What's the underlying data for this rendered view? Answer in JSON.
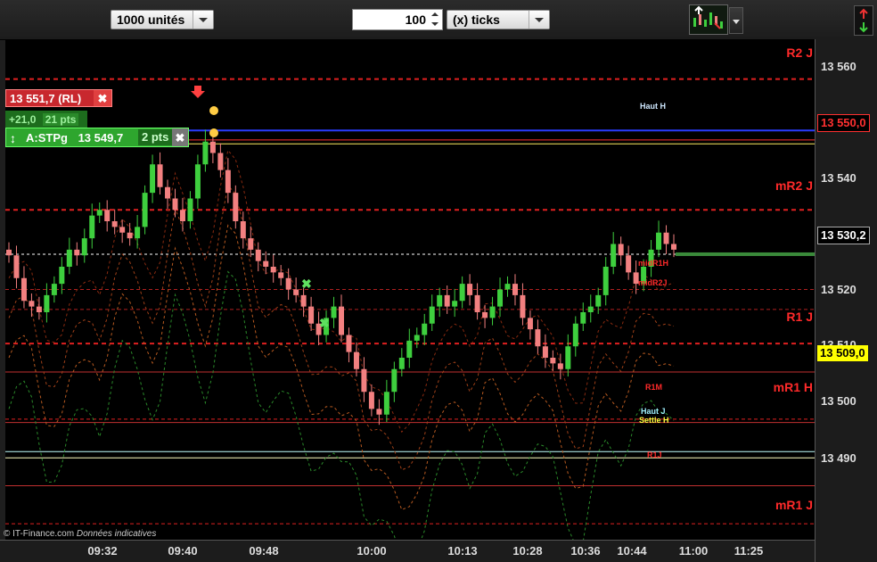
{
  "toolbar": {
    "quantity": "1000 unités",
    "tick_value": "100",
    "tick_unit": "(x) ticks"
  },
  "orders": {
    "rl_price": "13 551,7 (RL)",
    "pnl": "+21,0",
    "pnl_pts": "21 pts",
    "stop_label": "A:STPg",
    "stop_price": "13 549,7",
    "stop_pts": "2 pts"
  },
  "price_axis": {
    "ticks": [
      "13 560",
      "13 550,0",
      "13 540",
      "13 530,2",
      "13 520",
      "13 510",
      "13 509,0",
      "13 500",
      "13 490"
    ],
    "current_price": "13 530,2",
    "marker_price": "13 550,0",
    "yellow_price": "13 509,0"
  },
  "time_axis": {
    "ticks": [
      "09:32",
      "09:40",
      "09:48",
      "10:00",
      "10:13",
      "10:28",
      "10:36",
      "10:44",
      "11:00",
      "11:25"
    ]
  },
  "levels": {
    "r2j": "R2 J",
    "mr2j": "mR2 J",
    "r1j": "R1 J",
    "mr1h": "mR1 H",
    "mr1j": "mR1 J",
    "haut_h": "Haut H",
    "midr1h": "midR1H",
    "midr2j": "midR2J",
    "r1m": "R1M",
    "haut_j": "Haut J",
    "settle_h": "Settle H",
    "r1j_small": "R1J"
  },
  "credit": {
    "source": "© IT-Finance.com",
    "note": "Données indicatives"
  },
  "colors": {
    "bull": "#3ecf3e",
    "bear": "#f28080",
    "level_red": "#e02020",
    "blue_line": "#2a3cff",
    "yellow": "#ffff00"
  },
  "chart_data": {
    "type": "candlestick",
    "y_range": [
      13480,
      13568
    ],
    "x_ticks": [
      "09:32",
      "09:40",
      "09:48",
      "10:00",
      "10:13",
      "10:28",
      "10:36",
      "10:44",
      "11:00",
      "11:25"
    ],
    "levels": [
      {
        "name": "R2 J",
        "value": 13561
      },
      {
        "name": "Haut H",
        "value": 13551.8
      },
      {
        "name": "mR2 J",
        "value": 13538
      },
      {
        "name": "R1 J",
        "value": 13514.5
      },
      {
        "name": "mR1 H",
        "value": 13501.2
      },
      {
        "name": "Haut J",
        "value": 13495.5
      },
      {
        "name": "Settle H",
        "value": 13494.4
      },
      {
        "name": "mR1 J",
        "value": 13482.8
      }
    ],
    "closes": [
      13530,
      13526,
      13522,
      13521,
      13520,
      13523,
      13525,
      13528,
      13531,
      13530,
      13533,
      13537,
      13538,
      13536,
      13535,
      13534,
      13533,
      13535,
      13541,
      13546,
      13542,
      13540,
      13538,
      13536,
      13540,
      13546,
      13550,
      13548,
      13545,
      13541,
      13536,
      13533,
      13531,
      13529,
      13528,
      13527,
      13526,
      13524,
      13523,
      13521,
      13518,
      13516,
      13519,
      13521,
      13516,
      13513,
      13510,
      13506,
      13503,
      13502,
      13506,
      13510,
      13512,
      13515,
      13516,
      13518,
      13521,
      13523,
      13521,
      13522,
      13525,
      13523,
      13520,
      13519,
      13521,
      13524,
      13525,
      13523,
      13519,
      13517,
      13514,
      13512,
      13511,
      13510,
      13514,
      13518,
      13520,
      13521,
      13523,
      13528,
      13532,
      13530,
      13527,
      13525,
      13528,
      13531,
      13534,
      13532,
      13531
    ]
  }
}
